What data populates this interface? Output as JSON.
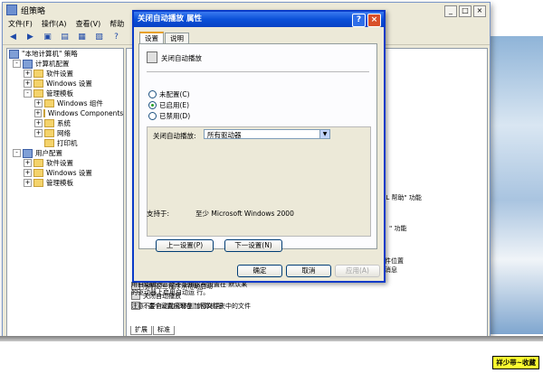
{
  "window": {
    "title": "组策略",
    "controls": [
      "_",
      "□",
      "×"
    ]
  },
  "menu": [
    "文件(F)",
    "操作(A)",
    "查看(V)",
    "帮助"
  ],
  "toolbar_icons": [
    "back-icon",
    "forward-icon",
    "up-folder-icon",
    "show-hide-tree-icon",
    "properties-icon",
    "export-icon",
    "help-icon"
  ],
  "tree": {
    "root": "\"本地计算机\" 策略",
    "nodes": [
      {
        "label": "计算机配置",
        "level": 1,
        "expander": "-"
      },
      {
        "label": "软件设置",
        "level": 2,
        "expander": "+"
      },
      {
        "label": "Windows 设置",
        "level": 2,
        "expander": "+"
      },
      {
        "label": "管理模板",
        "level": 2,
        "expander": "-"
      },
      {
        "label": "Windows 组件",
        "level": 3,
        "expander": "+"
      },
      {
        "label": "Windows Components",
        "level": 3,
        "expander": "+"
      },
      {
        "label": "系统",
        "level": 3,
        "expander": "+"
      },
      {
        "label": "网络",
        "level": 3,
        "expander": "+"
      },
      {
        "label": "打印机",
        "level": 3,
        "expander": ""
      },
      {
        "label": "用户配置",
        "level": 1,
        "expander": "-"
      },
      {
        "label": "软件设置",
        "level": 2,
        "expander": "+"
      },
      {
        "label": "Windows 设置",
        "level": 2,
        "expander": "+"
      },
      {
        "label": "管理模板",
        "level": 2,
        "expander": "+"
      }
    ]
  },
  "right_pane": {
    "fragments": [
      "TML 帮助\" 功能",
      "\" 功能",
      "件位置",
      "消息"
    ],
    "policies": [
      "限制这些程序从帮助启动",
      "关闭自动播放",
      "不要自动加密移到加密文件夹中的文件"
    ],
    "description": "用自动运行。您不能用这项设置在 默认某的驱动器上启用自动运 行。",
    "description_tail": "注意: 这个设置出现在 \"计算机配",
    "bottom_tabs": [
      "扩展",
      "标准"
    ]
  },
  "dialog": {
    "title": "关闭自动播放 属性",
    "tabs": [
      "设置",
      "说明"
    ],
    "setting_name": "关闭自动播放",
    "radios": [
      {
        "label": "未配置(C)",
        "selected": false
      },
      {
        "label": "已启用(E)",
        "selected": true
      },
      {
        "label": "已禁用(D)",
        "selected": false
      }
    ],
    "option_label": "关闭自动播放:",
    "option_value": "所有驱动器",
    "support_label": "支持于:",
    "support_value": "至少 Microsoft Windows 2000",
    "prev_button": "上一设置(P)",
    "next_button": "下一设置(N)",
    "ok_button": "确定",
    "cancel_button": "取消",
    "apply_button": "应用(A)"
  },
  "signature": "祥少带~收藏"
}
